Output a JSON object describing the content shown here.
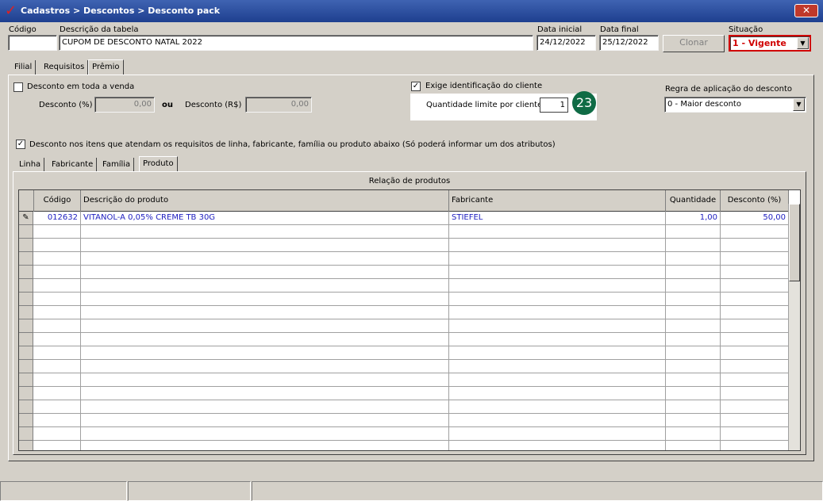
{
  "window": {
    "title": "Cadastros > Descontos > Desconto pack",
    "close_label": "✕"
  },
  "header": {
    "codigo_label": "Código",
    "codigo_value": "",
    "descricao_label": "Descrição da tabela",
    "descricao_value": "CUPOM DE DESCONTO NATAL 2022",
    "data_inicial_label": "Data inicial",
    "data_inicial_value": "24/12/2022",
    "data_final_label": "Data final",
    "data_final_value": "25/12/2022",
    "clonar_label": "Clonar",
    "situacao_label": "Situação",
    "situacao_value": "1 - Vigente",
    "situacao_color": "#d00000"
  },
  "tabs": [
    {
      "label": "Filial"
    },
    {
      "label": "Requisitos"
    },
    {
      "label": "Prêmio"
    }
  ],
  "premio": {
    "desconto_venda_label": "Desconto em toda a venda",
    "desconto_venda_checked": false,
    "desconto_pct_label": "Desconto (%)",
    "desconto_pct_value": "0,00",
    "ou_label": "ou",
    "desconto_rs_label": "Desconto (R$)",
    "desconto_rs_value": "0,00",
    "exige_label": "Exige identificação do cliente",
    "exige_checked": true,
    "quantidade_label": "Quantidade limite por cliente",
    "quantidade_value": "1",
    "badge": "23",
    "regra_label": "Regra de aplicação do desconto",
    "regra_value": "0 - Maior desconto",
    "itens_label": "Desconto nos itens que atendam os requisitos de linha, fabricante, família ou produto abaixo (Só poderá informar um dos atributos)",
    "itens_checked": true
  },
  "subtabs": [
    {
      "label": "Linha"
    },
    {
      "label": "Fabricante"
    },
    {
      "label": "Família"
    },
    {
      "label": "Produto"
    }
  ],
  "grid": {
    "title": "Relação de produtos",
    "columns": [
      "Código",
      "Descrição do produto",
      "Fabricante",
      "Quantidade",
      "Desconto (%)"
    ],
    "rows": [
      {
        "codigo": "012632",
        "descricao": "VITANOL-A 0,05% CREME TB 30G",
        "fabricante": "STIEFEL",
        "quantidade": "1,00",
        "desconto": "50,00"
      }
    ],
    "edit_icon": "✎",
    "text_color": "#2020c0"
  }
}
